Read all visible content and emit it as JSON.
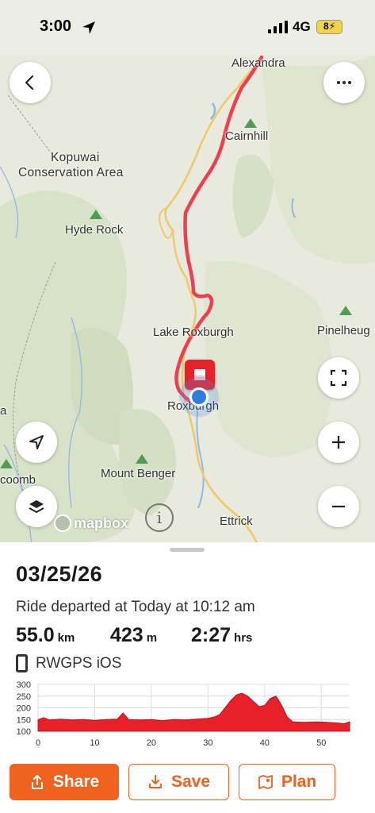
{
  "status_bar": {
    "time": "3:00",
    "network": "4G",
    "battery": "8"
  },
  "map": {
    "labels": {
      "alexandra": "Alexandra",
      "cairnhill": "Cairnhill",
      "kopuwai_line1": "Kopuwai",
      "kopuwai_line2": "Conservation Area",
      "hyde_rock": "Hyde Rock",
      "lake_roxburgh": "Lake Roxburgh",
      "pinelheug": "Pinelheug",
      "roxburgh": "Roxburgh",
      "edge_a": "a",
      "edge_coomb": "coomb",
      "mount_benger": "Mount Benger",
      "ettrick": "Ettrick"
    },
    "attribution": "mapbox",
    "info_glyph": "i",
    "icons": {
      "back": "chevron-left-icon",
      "more": "ellipsis-icon",
      "fullscreen": "expand-icon",
      "zoom_in": "plus-icon",
      "zoom_out": "minus-icon",
      "locate": "navigation-arrow-icon",
      "layers": "layers-icon"
    },
    "route_color": "#f03e4e"
  },
  "ride": {
    "date": "03/25/26",
    "departed": "Ride departed at Today at 10:12 am",
    "distance": {
      "value": "55.0",
      "unit": "km"
    },
    "elevation": {
      "value": "423",
      "unit": "m"
    },
    "duration": {
      "value": "2:27",
      "unit": "hrs"
    },
    "device": "RWGPS iOS"
  },
  "chart_data": {
    "type": "area",
    "title": "",
    "xlabel": "",
    "ylabel": "",
    "xlim": [
      0,
      55
    ],
    "ylim": [
      100,
      300
    ],
    "x_ticks": [
      0,
      10,
      20,
      30,
      40,
      50
    ],
    "y_ticks": [
      100,
      150,
      200,
      250,
      300
    ],
    "color": "#e8202a",
    "series": [
      {
        "x": [
          0,
          1,
          2,
          4,
          6,
          8,
          10,
          12,
          14,
          15,
          16,
          18,
          20,
          22,
          24,
          26,
          28,
          30,
          31,
          32,
          33,
          34,
          35,
          36,
          37,
          38,
          39,
          40,
          41,
          42,
          43,
          44,
          45,
          47,
          49,
          51,
          53,
          54,
          55
        ],
        "values": [
          150,
          158,
          148,
          152,
          148,
          150,
          146,
          150,
          152,
          178,
          150,
          148,
          150,
          145,
          150,
          148,
          152,
          155,
          160,
          170,
          200,
          230,
          255,
          262,
          250,
          228,
          205,
          210,
          240,
          250,
          210,
          160,
          140,
          138,
          140,
          138,
          135,
          132,
          140
        ]
      }
    ]
  },
  "actions": {
    "share": "Share",
    "save": "Save",
    "plan": "Plan"
  }
}
